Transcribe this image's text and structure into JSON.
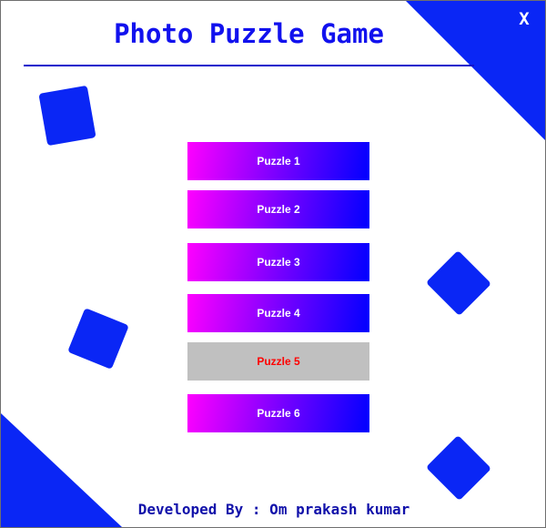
{
  "app": {
    "title": "Photo Puzzle Game",
    "close_label": "X",
    "footer": "Developed By : Om prakash kumar"
  },
  "puzzles": [
    {
      "label": "Puzzle 1",
      "state": "enabled"
    },
    {
      "label": "Puzzle 2",
      "state": "enabled"
    },
    {
      "label": "Puzzle 3",
      "state": "enabled"
    },
    {
      "label": "Puzzle 4",
      "state": "enabled"
    },
    {
      "label": "Puzzle 5",
      "state": "disabled"
    },
    {
      "label": "Puzzle 6",
      "state": "enabled"
    }
  ],
  "colors": {
    "accent": "#0a26f5",
    "title_text": "#1111ee",
    "button_gradient_start": "#ff00ff",
    "button_gradient_end": "#0000ff",
    "button_text": "#ffffff",
    "disabled_button_bg": "#c0c0c0",
    "disabled_button_text": "#ff0000",
    "footer_text": "#1111aa"
  }
}
